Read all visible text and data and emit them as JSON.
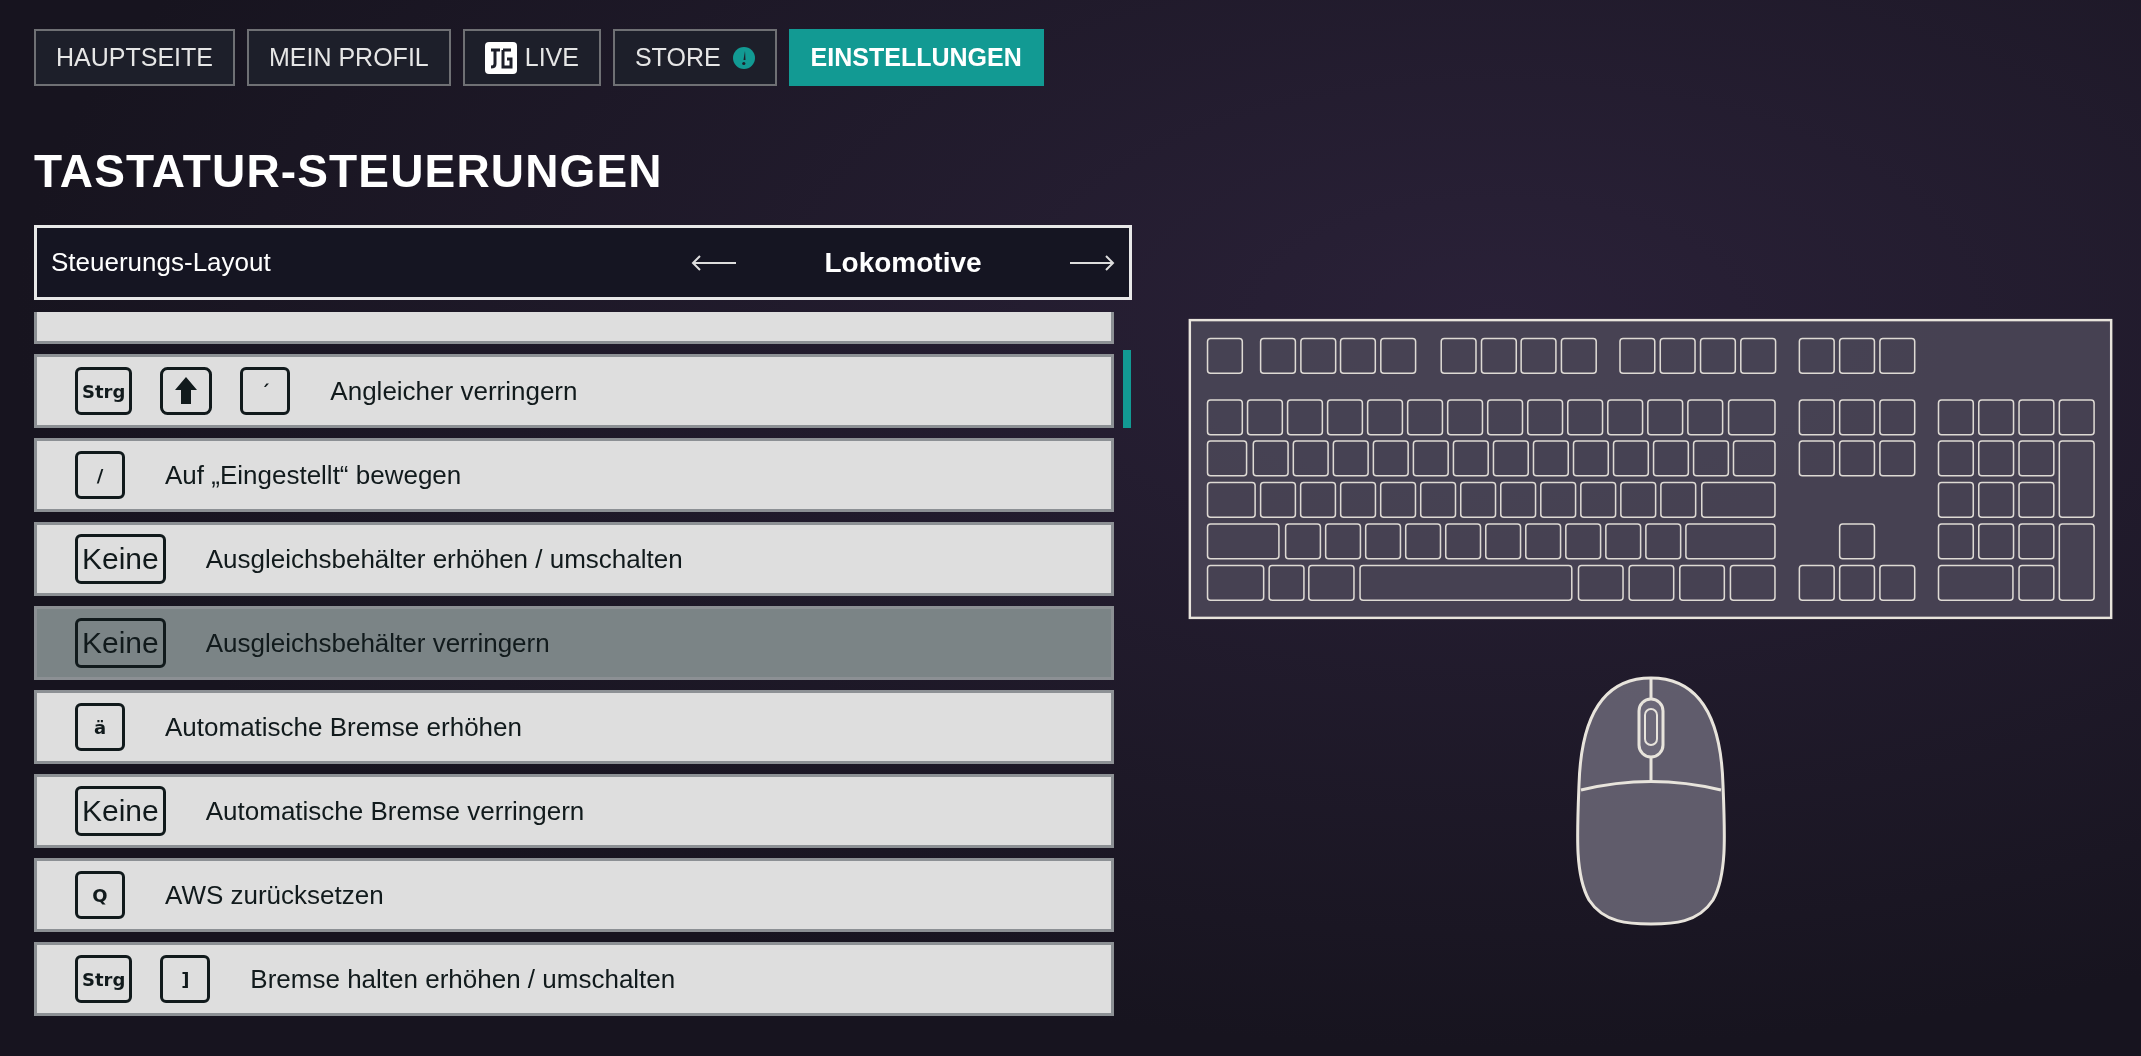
{
  "nav": [
    {
      "label": "HAUPTSEITE",
      "kind": "plain",
      "selected": false
    },
    {
      "label": "MEIN PROFIL",
      "kind": "plain",
      "selected": false
    },
    {
      "label": "LIVE",
      "kind": "logo",
      "selected": false
    },
    {
      "label": "STORE",
      "kind": "alert",
      "selected": false
    },
    {
      "label": "EINSTELLUNGEN",
      "kind": "plain",
      "selected": true
    }
  ],
  "heading": "TASTATUR-STEUERUNGEN",
  "layout_selector": {
    "label": "Steuerungs-Layout",
    "value": "Lokomotive"
  },
  "bindings": [
    {
      "kind": "cut-off",
      "selected": false
    },
    {
      "keys": [
        {
          "kind": "key",
          "label": "Strg"
        },
        {
          "kind": "shift"
        },
        {
          "kind": "key",
          "label": "´"
        }
      ],
      "action": "Angleicher verringern",
      "selected": false
    },
    {
      "keys": [
        {
          "kind": "key",
          "label": "/"
        }
      ],
      "action": "Auf „Eingestellt“ bewegen",
      "selected": false
    },
    {
      "keys": [
        {
          "kind": "none",
          "label": "Keine"
        }
      ],
      "action": "Ausgleichsbehälter erhöhen / umschalten",
      "selected": false
    },
    {
      "keys": [
        {
          "kind": "none",
          "label": "Keine"
        }
      ],
      "action": "Ausgleichsbehälter verringern",
      "selected": true
    },
    {
      "keys": [
        {
          "kind": "key",
          "label": "ä"
        }
      ],
      "action": "Automatische Bremse erhöhen",
      "selected": false
    },
    {
      "keys": [
        {
          "kind": "none",
          "label": "Keine"
        }
      ],
      "action": "Automatische Bremse verringern",
      "selected": false
    },
    {
      "keys": [
        {
          "kind": "key",
          "label": "Q"
        }
      ],
      "action": "AWS zurücksetzen",
      "selected": false
    },
    {
      "keys": [
        {
          "kind": "key",
          "label": "Strg"
        },
        {
          "kind": "key",
          "label": "]"
        }
      ],
      "action": "Bremse halten erhöhen / umschalten",
      "selected": false
    }
  ]
}
